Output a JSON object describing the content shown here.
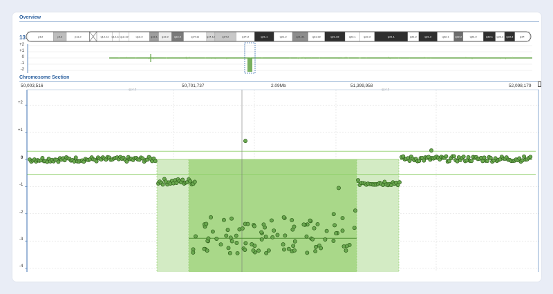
{
  "overview": {
    "title": "Overview",
    "chromosome": "13",
    "y_labels": [
      "+2",
      "+1",
      "0",
      "-1",
      "-2"
    ],
    "bands": [
      {
        "label": "p13",
        "color": "#ffffff",
        "w": 28
      },
      {
        "label": "p12",
        "color": "#bdbdbd",
        "w": 14
      },
      {
        "label": "p11.2",
        "color": "#ffffff",
        "w": 25
      },
      {
        "label": "cen",
        "color": "#ffffff",
        "w": 8
      },
      {
        "label": "q12.11",
        "color": "#ffffff",
        "w": 17
      },
      {
        "label": "q12.12",
        "color": "#ffffff",
        "w": 7
      },
      {
        "label": "q12.13",
        "color": "#ffffff",
        "w": 11
      },
      {
        "label": "q12.3",
        "color": "#ffffff",
        "w": 22
      },
      {
        "label": "q13.1",
        "color": "#9e9e9e",
        "w": 10
      },
      {
        "label": "q13.2",
        "color": "#eeeeee",
        "w": 14
      },
      {
        "label": "q13.3",
        "color": "#7a7a7a",
        "w": 13
      },
      {
        "label": "q14.11",
        "color": "#ffffff",
        "w": 25
      },
      {
        "label": "q14.12",
        "color": "#d6d6d6",
        "w": 9
      },
      {
        "label": "q14.2",
        "color": "#c8c8c8",
        "w": 23
      },
      {
        "label": "q14.3",
        "color": "#ffffff",
        "w": 20
      },
      {
        "label": "q21.1",
        "color": "#2f2f2f",
        "w": 21
      },
      {
        "label": "q21.2",
        "color": "#ffffff",
        "w": 20
      },
      {
        "label": "q21.31",
        "color": "#8d8d8d",
        "w": 17
      },
      {
        "label": "q21.32",
        "color": "#ffffff",
        "w": 18
      },
      {
        "label": "q21.33",
        "color": "#2f2f2f",
        "w": 22
      },
      {
        "label": "q22.1",
        "color": "#ffffff",
        "w": 16
      },
      {
        "label": "q22.3",
        "color": "#ffffff",
        "w": 16
      },
      {
        "label": "q31.1",
        "color": "#2f2f2f",
        "w": 36
      },
      {
        "label": "q31.2",
        "color": "#ffffff",
        "w": 12
      },
      {
        "label": "q31.3",
        "color": "#2f2f2f",
        "w": 20
      },
      {
        "label": "q32.1",
        "color": "#ffffff",
        "w": 18
      },
      {
        "label": "q32.2",
        "color": "#6d6d6d",
        "w": 10
      },
      {
        "label": "q32.3",
        "color": "#ffffff",
        "w": 22
      },
      {
        "label": "q33.1",
        "color": "#2f2f2f",
        "w": 13
      },
      {
        "label": "q33.2",
        "color": "#ffffff",
        "w": 10
      },
      {
        "label": "q33.3",
        "color": "#2f2f2f",
        "w": 11
      },
      {
        "label": "q34",
        "color": "#ffffff",
        "w": 16
      }
    ]
  },
  "section": {
    "title": "Chromosome Section",
    "positions": [
      "50,003,516",
      "50,701,737",
      "2.09Mb",
      "51,399,958",
      "52,098,179"
    ],
    "band_marks": [
      "q14.2",
      "q14.2"
    ],
    "y_labels": [
      "+2",
      "+1",
      "0",
      "-1",
      "-2",
      "-3",
      "-4"
    ]
  },
  "chart_data": {
    "type": "scatter",
    "title": "Chromosome Section",
    "x": [
      "50,003,516",
      "50,701,737",
      "51,399,958",
      "52,098,179"
    ],
    "ylim": [
      -4,
      2.3
    ],
    "segments": [
      {
        "region": "normal-left",
        "level": 0.0
      },
      {
        "region": "heterozygous-loss-left",
        "level": -0.82
      },
      {
        "region": "homozygous-loss",
        "level": -2.9
      },
      {
        "region": "heterozygous-loss-right",
        "level": -0.85
      },
      {
        "region": "normal-right",
        "level": 0.0
      }
    ],
    "outlier": {
      "x": "2.09Mb",
      "y": 0.68
    },
    "thresholds": [
      0.3,
      -0.55
    ],
    "point_color": "#6aa84f",
    "highlight_color": "#8fcf6a"
  }
}
